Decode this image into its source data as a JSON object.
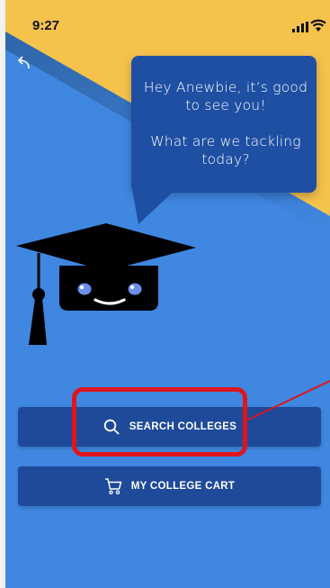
{
  "status_bar": {
    "time": "9:27",
    "signal_icon": "signal-bars-icon",
    "wifi_icon": "wifi-icon"
  },
  "nav": {
    "back_icon": "back-arrow-icon"
  },
  "greeting": {
    "line1": "Hey Anewbie, it’s good to see you!",
    "line2": "What are we tackling today?"
  },
  "mascot": {
    "icon": "graduation-cap-mascot"
  },
  "actions": {
    "search_colleges": {
      "label": "SEARCH COLLEGES",
      "icon": "search-icon"
    },
    "college_cart": {
      "label": "MY COLLEGE CART",
      "icon": "cart-icon"
    }
  },
  "colors": {
    "background_blue": "#3f87e1",
    "accent_yellow": "#f5c24c",
    "button_blue": "#1f4a9a",
    "bubble_blue": "#1f4fa3",
    "annotation_red": "#e0151b"
  }
}
